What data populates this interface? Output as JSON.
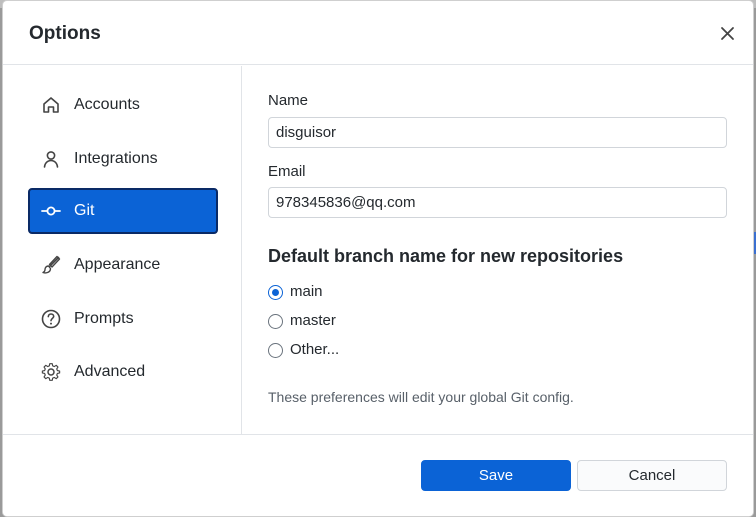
{
  "dialog": {
    "title": "Options"
  },
  "sidebar": {
    "items": [
      {
        "label": "Accounts",
        "icon": "home-icon",
        "active": false
      },
      {
        "label": "Integrations",
        "icon": "person-icon",
        "active": false
      },
      {
        "label": "Git",
        "icon": "git-commit-icon",
        "active": true
      },
      {
        "label": "Appearance",
        "icon": "paintbrush-icon",
        "active": false
      },
      {
        "label": "Prompts",
        "icon": "question-icon",
        "active": false
      },
      {
        "label": "Advanced",
        "icon": "gear-icon",
        "active": false
      }
    ]
  },
  "git": {
    "name_label": "Name",
    "name_value": "disguisor",
    "email_label": "Email",
    "email_value": "978345836@qq.com",
    "branch_title": "Default branch name for new repositories",
    "branch_options": [
      {
        "label": "main",
        "checked": true
      },
      {
        "label": "master",
        "checked": false
      },
      {
        "label": "Other...",
        "checked": false
      }
    ],
    "note": "These preferences will edit your global Git config."
  },
  "footer": {
    "save_label": "Save",
    "cancel_label": "Cancel"
  },
  "colors": {
    "accent": "#0b63d6",
    "active_border": "#0a2a66",
    "text": "#24292e",
    "muted": "#586069"
  }
}
